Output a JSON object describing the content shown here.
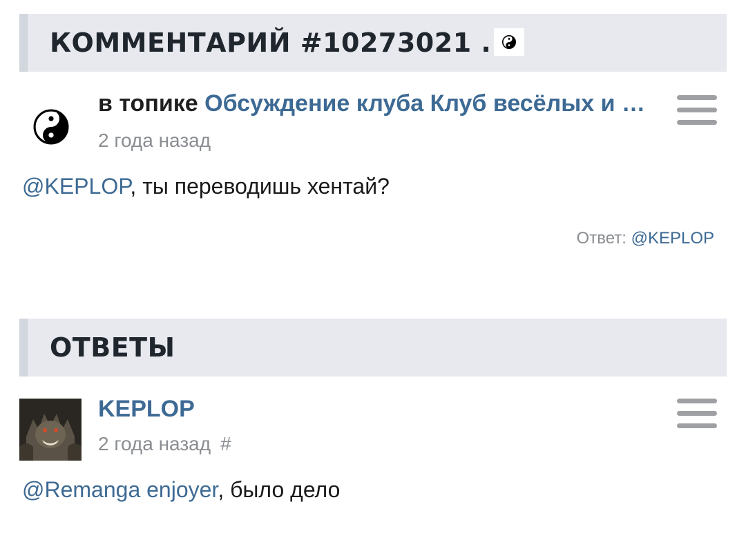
{
  "comment_header": {
    "title": "КОММЕНТАРИЙ #10273021 .",
    "icon": "yin-yang-icon"
  },
  "comment": {
    "topic_prefix": "в топике",
    "topic_link": "Обсуждение клуба Клуб весёлых и …",
    "time": "2 года назад",
    "mention": "@KEPLOP",
    "text": ", ты переводишь хентай?",
    "reply_label": "Ответ:",
    "reply_mention": "@KEPLOP"
  },
  "replies_header": {
    "title": "ОТВЕТЫ"
  },
  "reply": {
    "username": "KEPLOP",
    "time": "2 года назад",
    "hash": "#",
    "mention": "@Remanga enjoyer",
    "text": ", было дело"
  },
  "colors": {
    "link": "#3d6a94",
    "header_bg": "#e7e9ee",
    "muted": "#8a8d91"
  }
}
